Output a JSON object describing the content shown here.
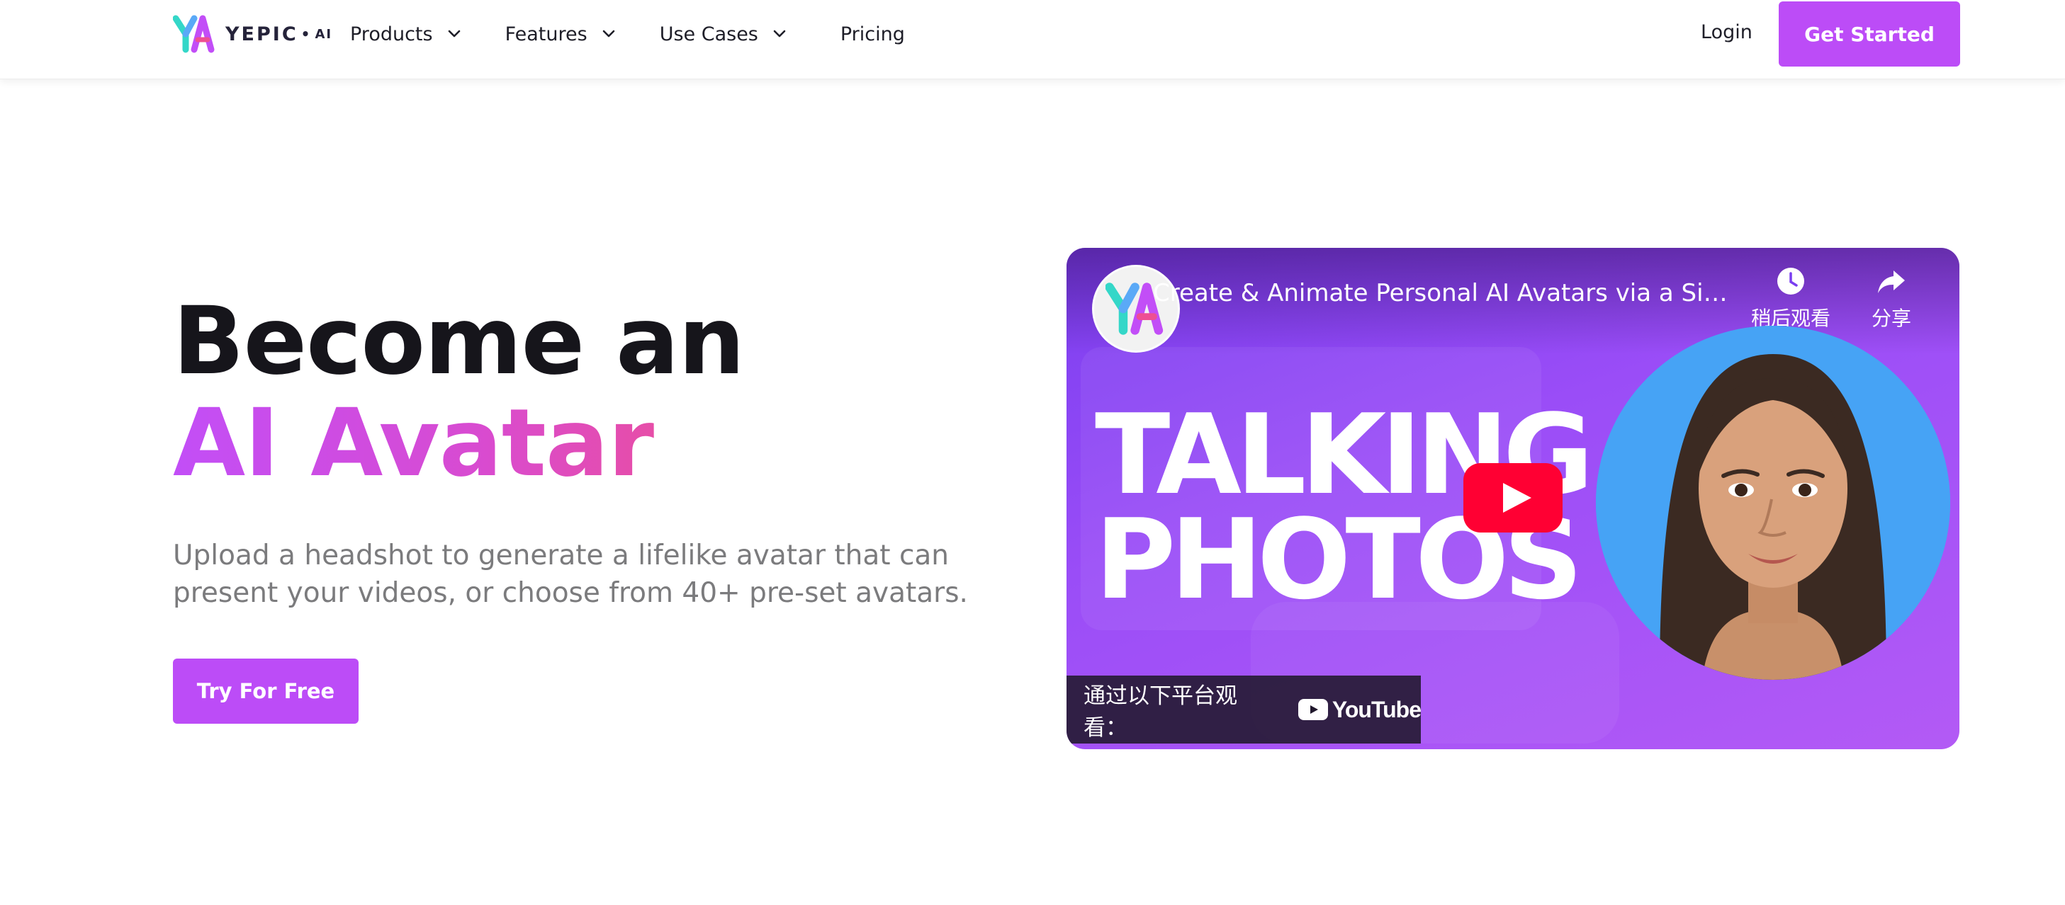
{
  "header": {
    "logo": {
      "text": "YEPIC",
      "suffix": "AI",
      "icon": "yepic-logo-icon"
    },
    "nav": [
      {
        "label": "Products",
        "icon": "chevron-down-icon"
      },
      {
        "label": "Features",
        "icon": "chevron-down-icon"
      },
      {
        "label": "Use Cases",
        "icon": "chevron-down-icon"
      },
      {
        "label": "Pricing"
      }
    ],
    "login_label": "Login",
    "get_started_label": "Get Started"
  },
  "hero": {
    "title_line1": "Become an",
    "title_line2": "AI Avatar",
    "subtitle": "Upload a headshot to generate a lifelike avatar that can present your videos, or choose from 40+ pre-set avatars.",
    "cta_label": "Try For Free"
  },
  "video": {
    "title": "Create & Animate Personal AI Avatars via a Simple Process",
    "watch_later_label": "稍后观看",
    "share_label": "分享",
    "thumbnail_text_line1": "TALKING",
    "thumbnail_text_line2": "PHOTOS",
    "watch_on_label": "通过以下平台观看：",
    "platform_label": "YouTube"
  },
  "colors": {
    "brand_purple": "#bc4cf7",
    "gradient_start": "#c24ef7",
    "gradient_end": "#ee4f93",
    "youtube_red": "#ff0033"
  }
}
